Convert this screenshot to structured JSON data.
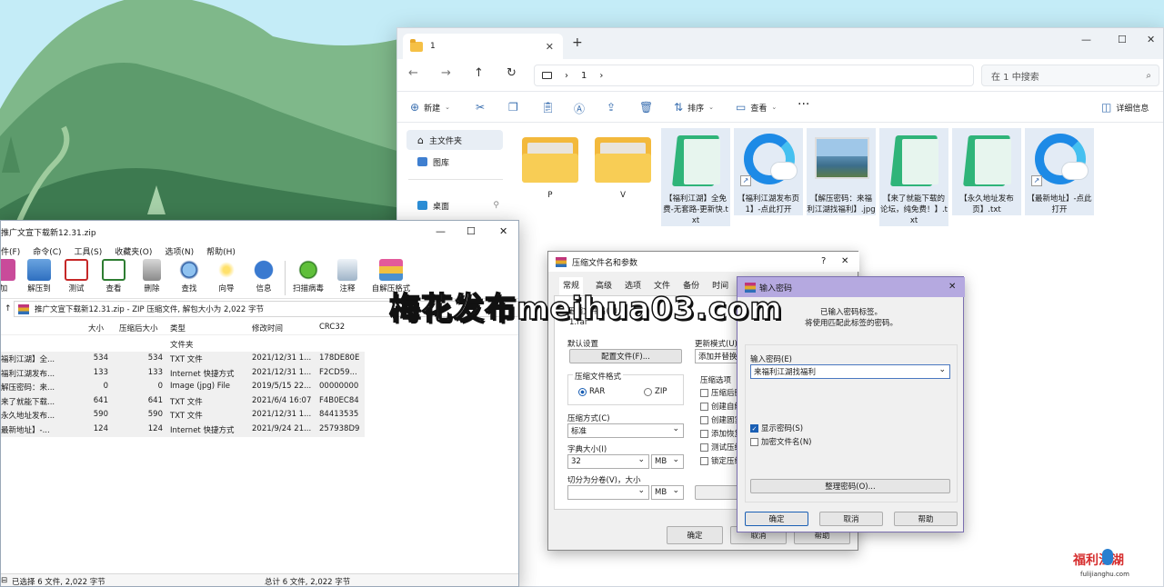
{
  "explorer": {
    "tab_title": "1",
    "address_segment": "1",
    "search_placeholder": "在 1 中搜索",
    "cmd_new": "新建",
    "cmd_sort": "排序",
    "cmd_view": "查看",
    "cmd_details": "详细信息",
    "sidebar": [
      {
        "label": "主文件夹"
      },
      {
        "label": "图库"
      },
      {
        "label": "桌面"
      }
    ],
    "files": [
      {
        "name": "P",
        "kind": "folder"
      },
      {
        "name": "V",
        "kind": "folder"
      },
      {
        "name": "【福利江湖】全免费-无套路-更新快.txt",
        "kind": "note"
      },
      {
        "name": "【福利江湖发布页1】-点此打开",
        "kind": "edge"
      },
      {
        "name": "【解压密码：来福利江湖找福利】.jpg",
        "kind": "img"
      },
      {
        "name": "【来了就能下载的论坛，纯免费！】.txt",
        "kind": "note"
      },
      {
        "name": "【永久地址发布页】.txt",
        "kind": "note"
      },
      {
        "name": "【最新地址】-点此打开",
        "kind": "edge"
      }
    ]
  },
  "winrar": {
    "title": "推广文宣下载新12.31.zip",
    "menu": [
      "文件(F)",
      "命令(C)",
      "工具(S)",
      "收藏夹(O)",
      "选项(N)",
      "帮助(H)"
    ],
    "menu_first_visible": "件(F)",
    "toolbar": [
      "加",
      "解压到",
      "测试",
      "查看",
      "删除",
      "查找",
      "向导",
      "信息",
      "扫描病毒",
      "注释",
      "自解压格式"
    ],
    "path": "推广文宣下载新12.31.zip - ZIP 压缩文件, 解包大小为 2,022 字节",
    "columns": {
      "size": "大小",
      "packed": "压缩后大小",
      "type": "类型",
      "modified": "修改时间",
      "crc": "CRC32"
    },
    "folder_row": "文件夹",
    "rows": [
      {
        "name": "福利江湖】全...",
        "size": "534",
        "packed": "534",
        "type": "TXT 文件",
        "modified": "2021/12/31 1...",
        "crc": "178DE80E"
      },
      {
        "name": "福利江湖发布...",
        "size": "133",
        "packed": "133",
        "type": "Internet 快捷方式",
        "modified": "2021/12/31 1...",
        "crc": "F2CD59..."
      },
      {
        "name": "解压密码：来...",
        "size": "0",
        "packed": "0",
        "type": "Image (jpg) File",
        "modified": "2019/5/15 22...",
        "crc": "00000000"
      },
      {
        "name": "来了就能下载...",
        "size": "641",
        "packed": "641",
        "type": "TXT 文件",
        "modified": "2021/6/4 16:07",
        "crc": "F4B0EC84"
      },
      {
        "name": "永久地址发布...",
        "size": "590",
        "packed": "590",
        "type": "TXT 文件",
        "modified": "2021/12/31 1...",
        "crc": "84413535"
      },
      {
        "name": "最新地址】-...",
        "size": "124",
        "packed": "124",
        "type": "Internet 快捷方式",
        "modified": "2021/9/24 21...",
        "crc": "257938D9"
      }
    ],
    "status_left": "已选择 6 文件, 2,022 字节",
    "status_right": "总计 6 文件, 2,022 字节"
  },
  "archive_dialog": {
    "title": "压缩文件名和参数",
    "tabs": [
      "常规",
      "高级",
      "选项",
      "文件",
      "备份",
      "时间"
    ],
    "archive_name_partial": "压缩文件名(A)",
    "archive_ext": "1.rar",
    "default_settings": "默认设置",
    "profile_button": "配置文件(F)...",
    "update_mode": "更新模式(U)",
    "update_value": "添加并替换",
    "format_group": "压缩文件格式",
    "format_rar": "RAR",
    "format_zip": "ZIP",
    "options_group": "压缩选项",
    "options": [
      "压缩后删除",
      "创建自解压",
      "创建固实",
      "添加恢复",
      "测试压缩",
      "锁定压缩"
    ],
    "method_label": "压缩方式(C)",
    "method_value": "标准",
    "dict_label": "字典大小(I)",
    "dict_value": "32",
    "dict_unit": "MB",
    "split_label": "切分为分卷(V)，大小",
    "split_unit": "MB",
    "ok": "确定",
    "cancel": "取消",
    "help": "帮助"
  },
  "password_dialog": {
    "title": "输入密码",
    "info_line1": "已输入密码标签。",
    "info_line2": "将使用匹配此标签的密码。",
    "label": "输入密码(E)",
    "value": "来福利江湖找福利",
    "show_password": "显示密码(S)",
    "encrypt_names": "加密文件名(N)",
    "organize": "整理密码(O)...",
    "ok": "确定",
    "cancel": "取消",
    "help": "帮助"
  },
  "watermark": "梅花发布meihua03.com",
  "logo": {
    "title": "福利江湖",
    "url": "fulijianghu.com"
  }
}
